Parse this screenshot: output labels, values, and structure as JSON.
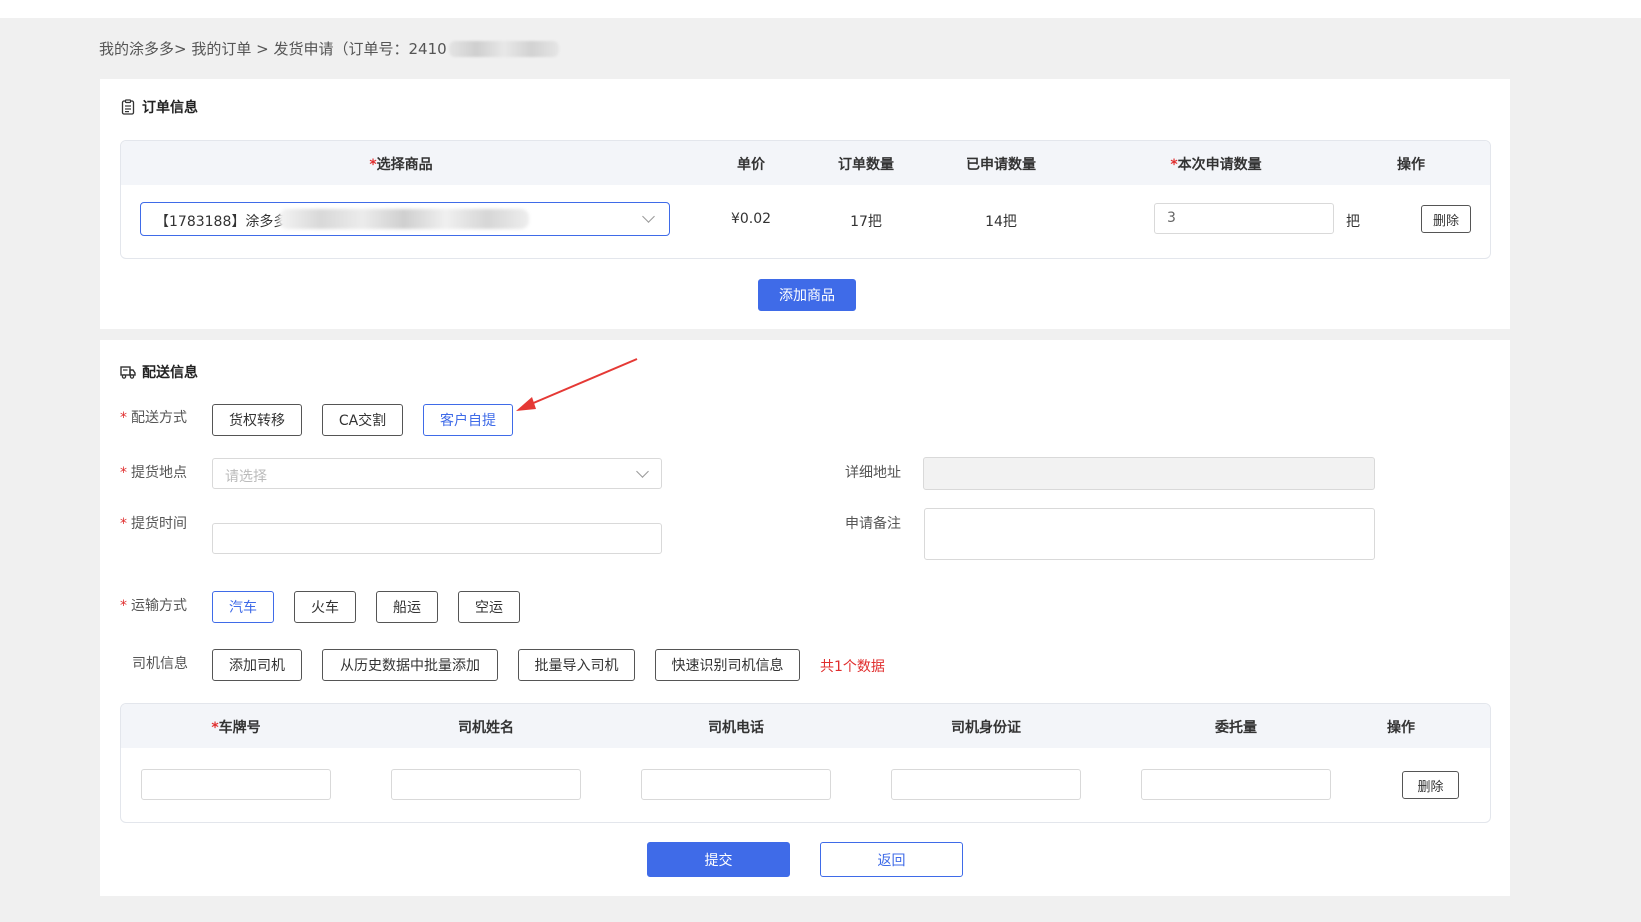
{
  "breadcrumb": {
    "part1": "我的涂多多>",
    "part2": "我的订单",
    "sep": ">",
    "part3": "发货申请（订单号：2410"
  },
  "order_section": {
    "title": "订单信息",
    "icon": "clipboard-icon",
    "columns": {
      "product": "选择商品",
      "unit_price": "单价",
      "order_qty": "订单数量",
      "applied_qty": "已申请数量",
      "this_qty": "本次申请数量",
      "action": "操作"
    },
    "row": {
      "product": "【1783188】涂多多",
      "unit_price": "¥0.02",
      "order_qty": "17把",
      "applied_qty": "14把",
      "this_qty_value": "3",
      "unit": "把",
      "delete_label": "删除"
    },
    "add_product_label": "添加商品"
  },
  "delivery_section": {
    "title": "配送信息",
    "icon": "truck-icon",
    "method_label": "配送方式",
    "methods": [
      "货权转移",
      "CA交割",
      "客户自提"
    ],
    "selected_method": "客户自提",
    "pickup_location_label": "提货地点",
    "pickup_location_placeholder": "请选择",
    "detail_address_label": "详细地址",
    "pickup_time_label": "提货时间",
    "remark_label": "申请备注",
    "transport_label": "运输方式",
    "transports": [
      "汽车",
      "火车",
      "船运",
      "空运"
    ],
    "selected_transport": "汽车",
    "driver_label": "司机信息",
    "driver_buttons": [
      "添加司机",
      "从历史数据中批量添加",
      "批量导入司机",
      "快速识别司机信息"
    ],
    "driver_count": "共1个数据",
    "driver_columns": {
      "plate": "车牌号",
      "name": "司机姓名",
      "phone": "司机电话",
      "id": "司机身份证",
      "amount": "委托量",
      "action": "操作"
    },
    "driver_row_delete": "删除",
    "submit_label": "提交",
    "back_label": "返回"
  },
  "colors": {
    "primary": "#3f6be8",
    "required": "#e02d2d",
    "arrow": "#e53935"
  }
}
